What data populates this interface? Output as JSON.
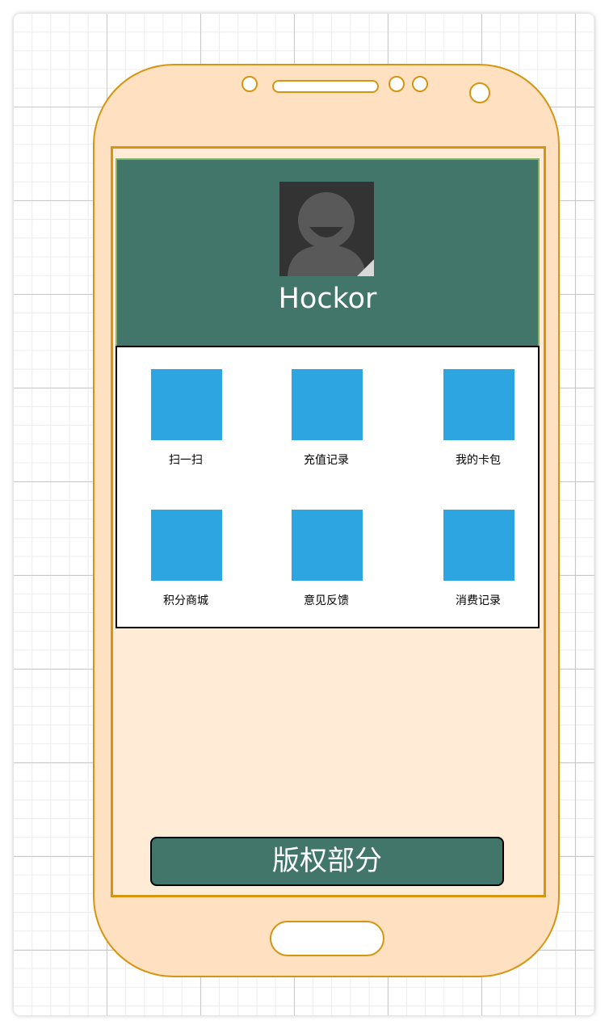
{
  "profile": {
    "name": "Hockor"
  },
  "menu": {
    "items": [
      {
        "label": "扫一扫"
      },
      {
        "label": "充值记录"
      },
      {
        "label": "我的卡包"
      },
      {
        "label": "积分商城"
      },
      {
        "label": "意见反馈"
      },
      {
        "label": "消费记录"
      }
    ]
  },
  "footer": {
    "label": "版权部分"
  },
  "colors": {
    "header": "#42766a",
    "tile": "#2ca5e0",
    "phone_body": "#ffe0c0",
    "phone_outline": "#d59511"
  }
}
